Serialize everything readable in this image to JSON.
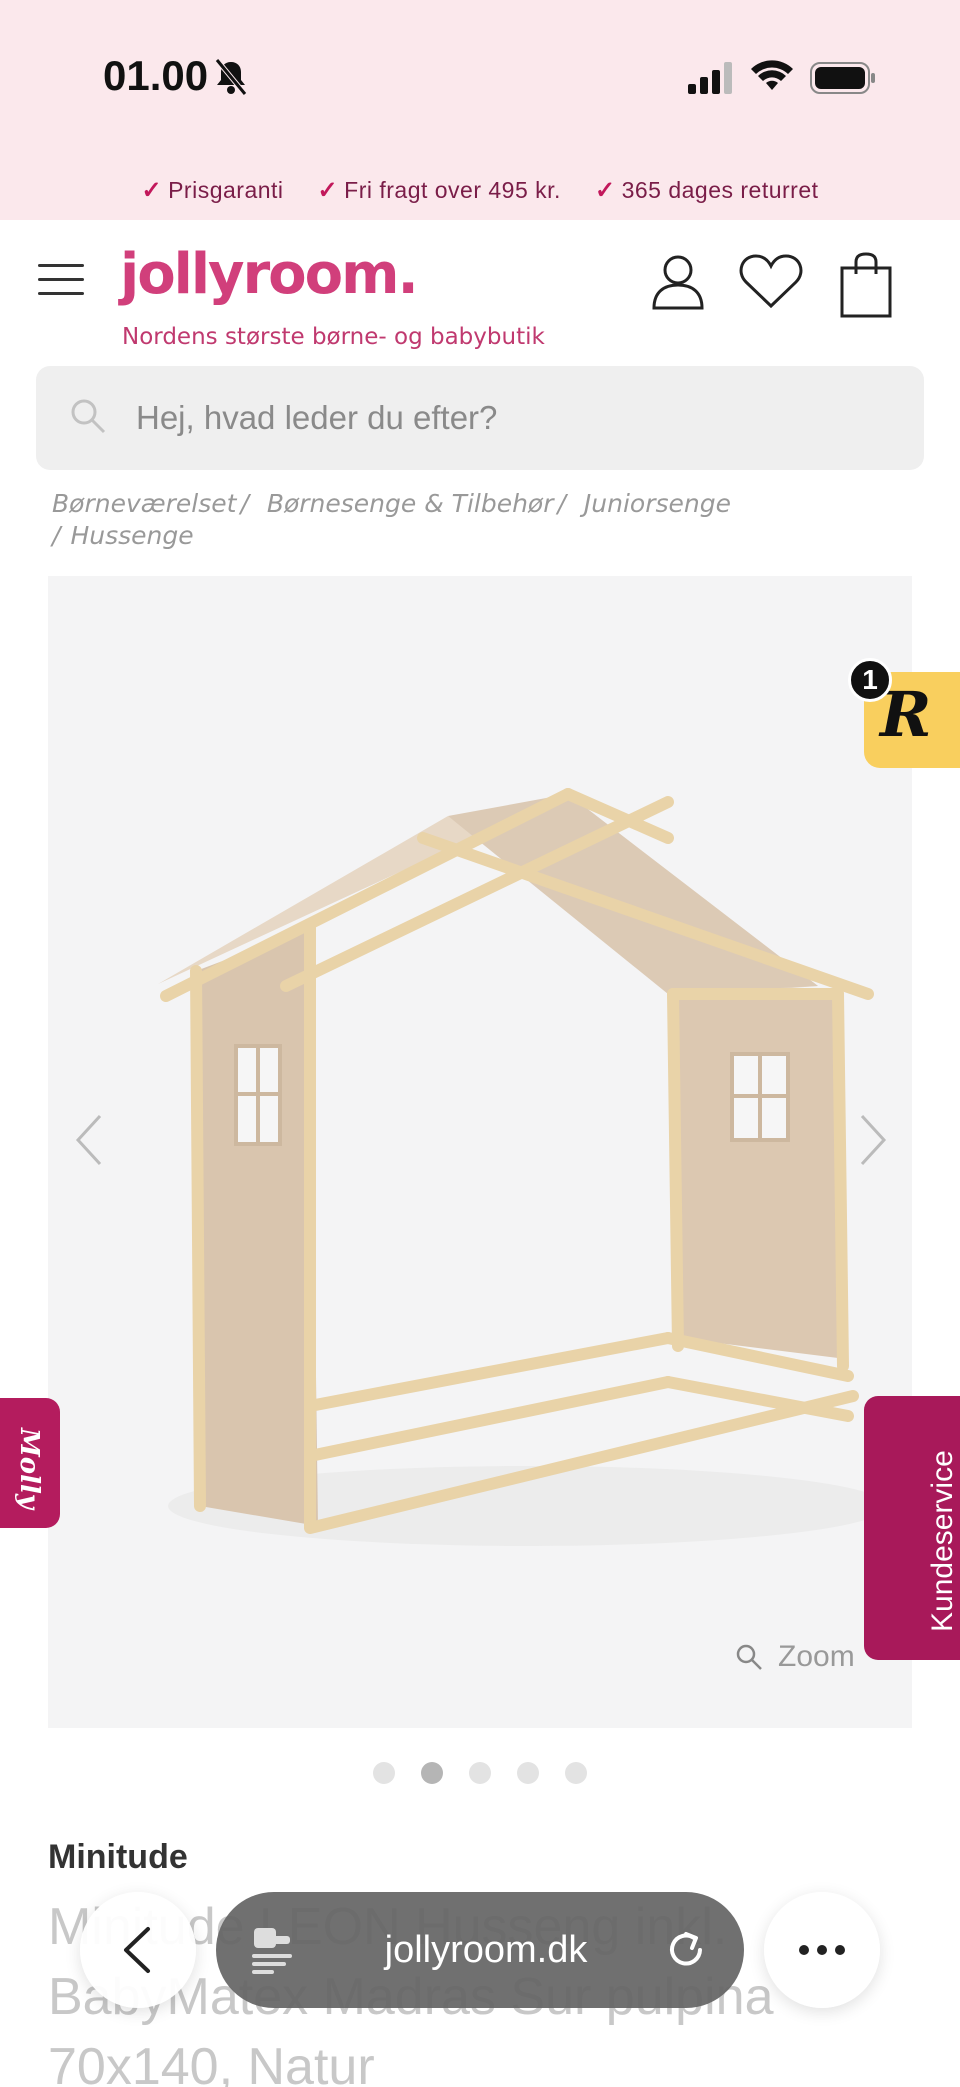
{
  "status_bar": {
    "time": "01.00"
  },
  "usp": [
    {
      "label": "Prisgaranti"
    },
    {
      "label": "Fri fragt over 495 kr."
    },
    {
      "label": "365 dages returret"
    }
  ],
  "header": {
    "logo": "jollyroom.",
    "tagline": "Nordens største børne- og babybutik"
  },
  "search": {
    "placeholder": "Hej, hvad leder du efter?"
  },
  "breadcrumb": [
    "Børneværelset",
    "Børnesenge & Tilbehør",
    "Juniorsenge",
    "Hussenge"
  ],
  "gallery": {
    "zoom_label": "Zoom",
    "dot_count": 5,
    "active_index": 1
  },
  "review_badge": {
    "letter": "R",
    "count": "1"
  },
  "molly": {
    "label": "Molly"
  },
  "customer_service": {
    "label": "Kundeservice"
  },
  "product": {
    "brand": "Minitude",
    "title": "Minitude LEON Husseng inkl. BabyMatex Madras Sur pulpina 70x140, Natur"
  },
  "browser": {
    "url": "jollyroom.dk"
  },
  "colors": {
    "accent": "#d13f7b",
    "usp_text": "#7a1d48",
    "status_bg": "#fbe8ec",
    "kundeservice": "#a8195a"
  }
}
